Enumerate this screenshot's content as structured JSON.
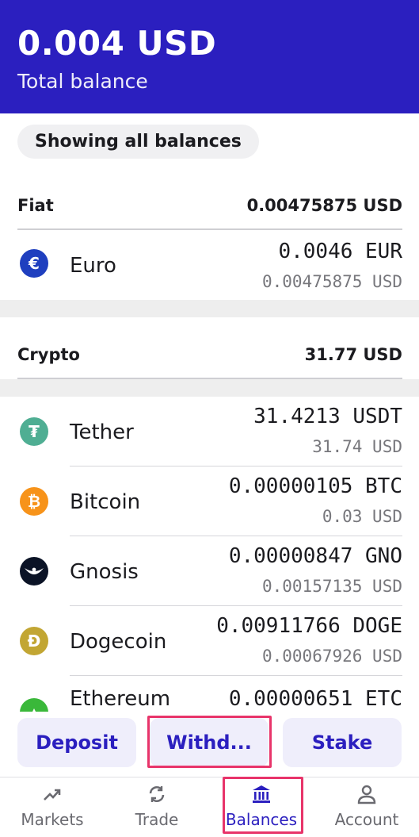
{
  "header": {
    "amount": "0.004 USD",
    "caption": "Total balance"
  },
  "filter_pill": "Showing all balances",
  "fiat": {
    "label": "Fiat",
    "total": "0.00475875 USD",
    "items": [
      {
        "name": "Euro",
        "qty": "0.0046 EUR",
        "usd": "0.00475875 USD",
        "icon": "euro-icon",
        "color": "#1f3fbf",
        "glyph": "€"
      }
    ]
  },
  "crypto": {
    "label": "Crypto",
    "total": "31.77 USD",
    "items": [
      {
        "name": "Tether",
        "qty": "31.4213 USDT",
        "usd": "31.74 USD",
        "icon": "tether-icon",
        "color": "#4fae93",
        "glyph": "₮"
      },
      {
        "name": "Bitcoin",
        "qty": "0.00000105 BTC",
        "usd": "0.03 USD",
        "icon": "bitcoin-icon",
        "color": "#f7931a",
        "glyph": "₿"
      },
      {
        "name": "Gnosis",
        "qty": "0.00000847 GNO",
        "usd": "0.00157135 USD",
        "icon": "gnosis-icon",
        "color": "#0b1326",
        "glyph": "◆"
      },
      {
        "name": "Dogecoin",
        "qty": "0.00911766 DOGE",
        "usd": "0.00067926 USD",
        "icon": "dogecoin-icon",
        "color": "#c2a633",
        "glyph": "Đ"
      },
      {
        "name": "Ethereum",
        "qty": "0.00000651 ETC",
        "usd": "",
        "icon": "ethereum-classic-icon",
        "color": "#3ab83a",
        "glyph": "▲"
      }
    ]
  },
  "actions": {
    "deposit": "Deposit",
    "withdraw": "Withd...",
    "stake": "Stake"
  },
  "nav": {
    "markets": "Markets",
    "trade": "Trade",
    "balances": "Balances",
    "account": "Account"
  },
  "colors": {
    "brand": "#2b1fbf",
    "highlight": "#e8346a"
  }
}
